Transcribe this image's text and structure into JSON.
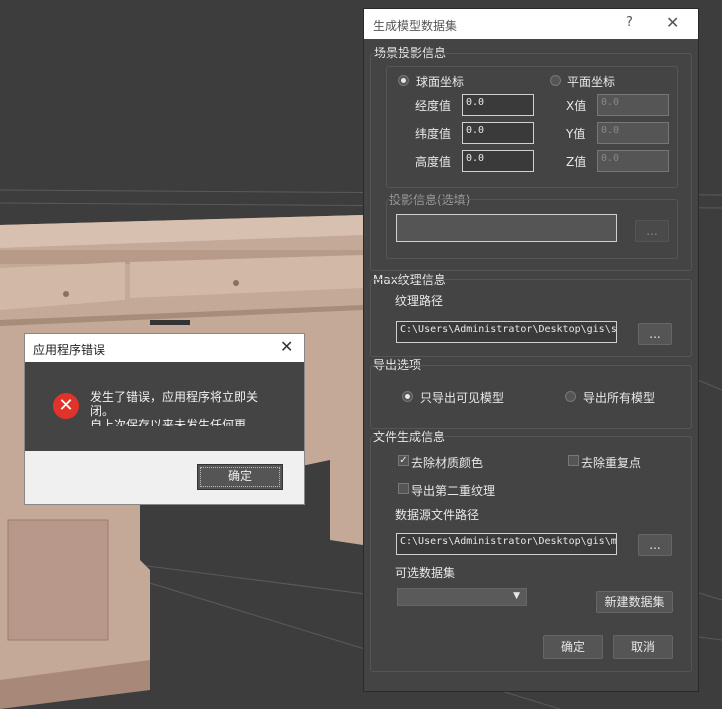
{
  "dialog": {
    "title": "生成模型数据集",
    "help": "?",
    "close": "✕",
    "projection": {
      "group_label": "场景投影信息",
      "sphere_label": "球面坐标",
      "plane_label": "平面坐标",
      "lon_label": "经度值",
      "lat_label": "纬度值",
      "height_label": "高度值",
      "lon_value": "0.0",
      "lat_value": "0.0",
      "height_value": "0.0",
      "x_label": "X值",
      "y_label": "Y值",
      "z_label": "Z值",
      "x_value": "0.0",
      "y_value": "0.0",
      "z_value": "0.0",
      "proj_info_label": "投影信息(选填)",
      "proj_info_value": "",
      "proj_browse": "..."
    },
    "texture": {
      "group_label": "Max纹理信息",
      "path_label": "纹理路径",
      "path_value": "C:\\Users\\Administrator\\Desktop\\gis\\s",
      "browse": "..."
    },
    "export": {
      "group_label": "导出选项",
      "visible_only": "只导出可见模型",
      "all_models": "导出所有模型"
    },
    "file": {
      "group_label": "文件生成信息",
      "remove_material_color": "去除材质颜色",
      "remove_duplicate_points": "去除重复点",
      "export_second_texture": "导出第二重纹理",
      "datasource_label": "数据源文件路径",
      "datasource_value": "C:\\Users\\Administrator\\Desktop\\gis\\m",
      "browse": "...",
      "optional_dataset_label": "可选数据集",
      "optional_dataset_value": "",
      "new_dataset": "新建数据集"
    },
    "ok": "确定",
    "cancel": "取消"
  },
  "error_dialog": {
    "title": "应用程序错误",
    "close": "✕",
    "message": "发生了错误，应用程序将立即关闭。",
    "message_cut": "自上次保存以来未发生任何更",
    "ok": "确定"
  }
}
